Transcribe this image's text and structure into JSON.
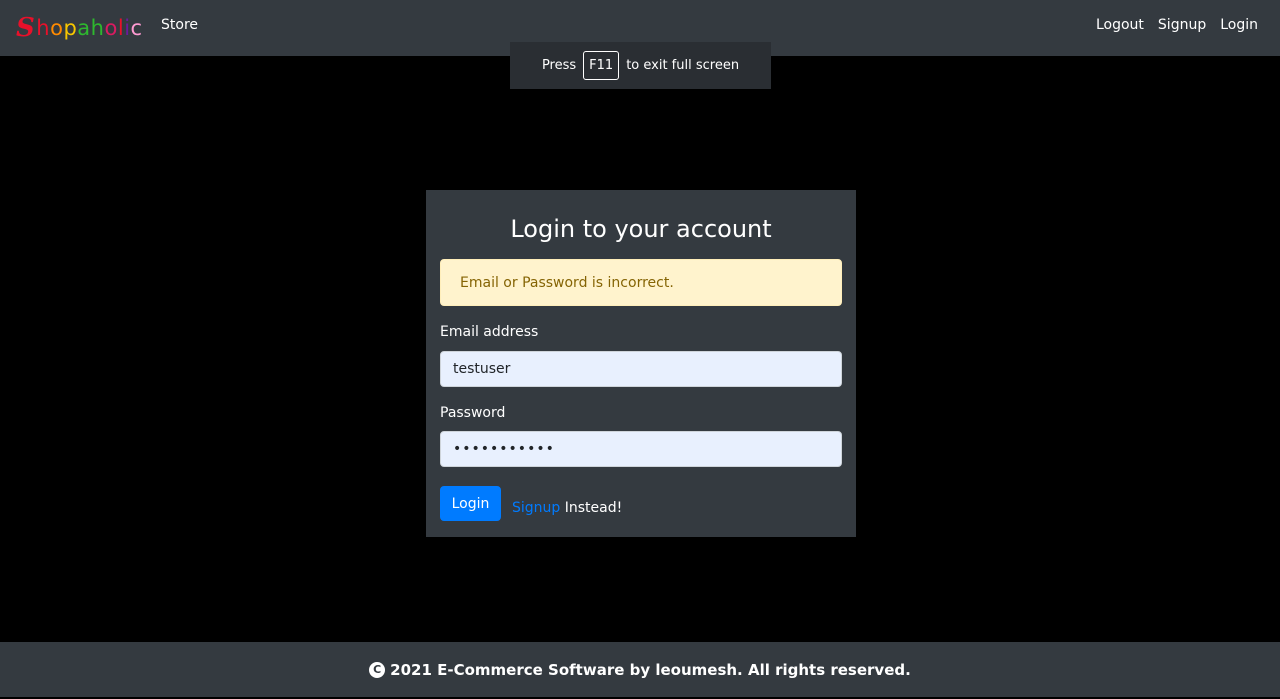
{
  "navbar": {
    "brand_letters": [
      {
        "char": "S",
        "color": "#e8102a"
      },
      {
        "char": "h",
        "color": "#e8102a"
      },
      {
        "char": "o",
        "color": "#ff8a00"
      },
      {
        "char": "p",
        "color": "#f7c600"
      },
      {
        "char": "a",
        "color": "#2eb82e"
      },
      {
        "char": "h",
        "color": "#2eb82e"
      },
      {
        "char": "o",
        "color": "#d81b60"
      },
      {
        "char": "l",
        "color": "#e8102a"
      },
      {
        "char": "i",
        "color": "#6a1b9a"
      },
      {
        "char": "c",
        "color": "#ff9bd2"
      }
    ],
    "store_label": "Store",
    "right_links": [
      "Logout",
      "Signup",
      "Login"
    ]
  },
  "fullscreen_notice": {
    "before": "Press",
    "key": "F11",
    "after": "to exit full screen"
  },
  "login_card": {
    "title": "Login to your account",
    "alert_text": "Email or Password is incorrect.",
    "email_label": "Email address",
    "email_value": "testuser",
    "password_label": "Password",
    "password_value": "•••••••••••",
    "login_button": "Login",
    "signup_link": "Signup",
    "signup_suffix": "Instead!"
  },
  "footer": {
    "copyright_symbol": "C",
    "text": "2021 E-Commerce Software by leoumesh. All rights reserved."
  },
  "colors": {
    "navbar_bg": "#343a40",
    "page_bg": "#000000",
    "alert_bg": "#fff3cd",
    "alert_text": "#856404",
    "primary": "#007bff",
    "input_bg": "#e8f0fe"
  }
}
